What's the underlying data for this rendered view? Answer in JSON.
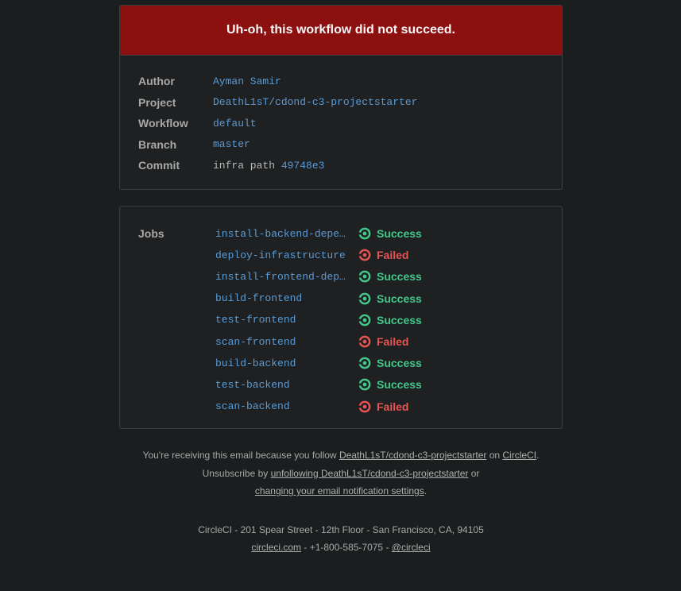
{
  "banner": {
    "title": "Uh-oh, this workflow did not succeed.",
    "color": "#8c1010"
  },
  "meta": {
    "author_label": "Author",
    "author": "Ayman Samir",
    "project_label": "Project",
    "project": "DeathL1sT/cdond-c3-projectstarter",
    "workflow_label": "Workflow",
    "workflow": "default",
    "branch_label": "Branch",
    "branch": "master",
    "commit_label": "Commit",
    "commit_message": "infra path",
    "commit_hash": "49748e3"
  },
  "jobs": {
    "label": "Jobs",
    "items": [
      {
        "name": "install-backend-dependencies",
        "status": "Success"
      },
      {
        "name": "deploy-infrastructure",
        "status": "Failed"
      },
      {
        "name": "install-frontend-dependencies",
        "status": "Success"
      },
      {
        "name": "build-frontend",
        "status": "Success"
      },
      {
        "name": "test-frontend",
        "status": "Success"
      },
      {
        "name": "scan-frontend",
        "status": "Failed"
      },
      {
        "name": "build-backend",
        "status": "Success"
      },
      {
        "name": "test-backend",
        "status": "Success"
      },
      {
        "name": "scan-backend",
        "status": "Failed"
      }
    ],
    "success_color": "#42c88a",
    "failed_color": "#e85454"
  },
  "footer": {
    "line1_prefix": "You're receiving this email because you follow ",
    "line1_project_link": "DeathL1sT/cdond-c3-projectstarter",
    "line1_mid": " on ",
    "line1_circle_link": "CircleCI",
    "line1_suffix": ".",
    "line2_prefix": "Unsubscribe by ",
    "line2_unfollow_link": "unfollowing DeathL1sT/cdond-c3-projectstarter",
    "line2_mid": " or ",
    "line2_settings_link": "changing your email notification settings",
    "line2_suffix": ".",
    "address": "CircleCI - 201 Spear Street - 12th Floor - San Francisco, CA, 94105",
    "site_link": "circleci.com",
    "phone": " - +1-800-585-7075 - ",
    "twitter_link": "@circleci"
  }
}
